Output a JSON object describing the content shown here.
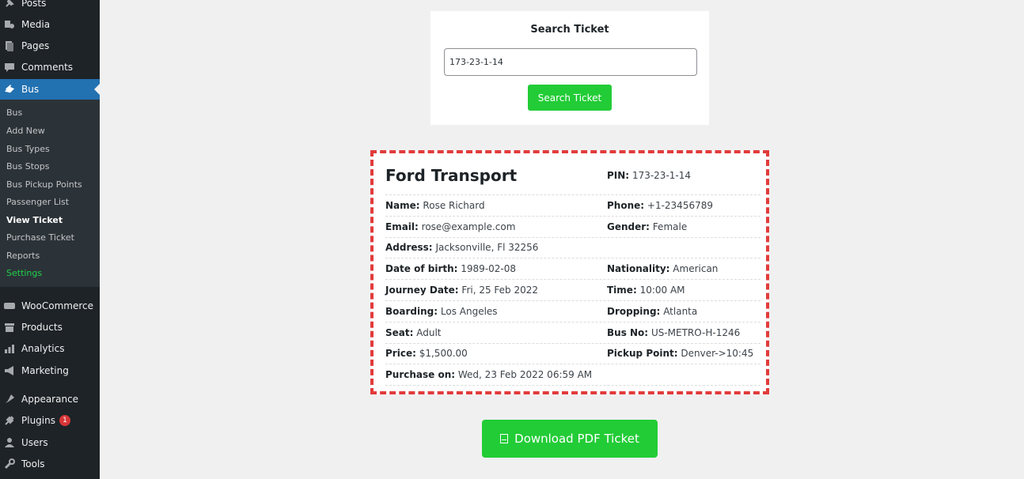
{
  "sidebar": {
    "top_items": [
      {
        "label": "Posts",
        "icon": "pin-icon"
      },
      {
        "label": "Media",
        "icon": "media-icon"
      },
      {
        "label": "Pages",
        "icon": "pages-icon"
      },
      {
        "label": "Comments",
        "icon": "comment-icon"
      }
    ],
    "active_item": {
      "label": "Bus",
      "icon": "bus-icon"
    },
    "submenu": [
      {
        "label": "Bus"
      },
      {
        "label": "Add New"
      },
      {
        "label": "Bus Types"
      },
      {
        "label": "Bus Stops"
      },
      {
        "label": "Bus Pickup Points"
      },
      {
        "label": "Passenger List"
      },
      {
        "label": "View Ticket"
      },
      {
        "label": "Purchase Ticket"
      },
      {
        "label": "Reports"
      },
      {
        "label": "Settings"
      }
    ],
    "bottom_items": [
      {
        "label": "WooCommerce",
        "icon": "woo-icon"
      },
      {
        "label": "Products",
        "icon": "box-icon"
      },
      {
        "label": "Analytics",
        "icon": "chart-icon"
      },
      {
        "label": "Marketing",
        "icon": "megaphone-icon"
      },
      {
        "label": "Appearance",
        "icon": "brush-icon"
      },
      {
        "label": "Plugins",
        "icon": "plug-icon",
        "badge": "1"
      },
      {
        "label": "Users",
        "icon": "user-icon"
      },
      {
        "label": "Tools",
        "icon": "wrench-icon"
      }
    ]
  },
  "search": {
    "title": "Search Ticket",
    "input_value": "173-23-1-14",
    "button_label": "Search Ticket"
  },
  "ticket": {
    "company": "Ford Transport",
    "pin_label": "PIN:",
    "pin": "173-23-1-14",
    "name_label": "Name:",
    "name": "Rose Richard",
    "phone_label": "Phone:",
    "phone": "+1-23456789",
    "email_label": "Email:",
    "email": "rose@example.com",
    "gender_label": "Gender:",
    "gender": "Female",
    "address_label": "Address:",
    "address": "Jacksonville, Fl 32256",
    "dob_label": "Date of birth:",
    "dob": "1989-02-08",
    "nationality_label": "Nationality:",
    "nationality": "American",
    "journey_label": "Journey Date:",
    "journey": "Fri, 25 Feb 2022",
    "time_label": "Time:",
    "time": "10:00 AM",
    "boarding_label": "Boarding:",
    "boarding": "Los Angeles",
    "dropping_label": "Dropping:",
    "dropping": "Atlanta",
    "seat_label": "Seat:",
    "seat": "Adult",
    "busno_label": "Bus No:",
    "busno": "US-METRO-H-1246",
    "price_label": "Price:",
    "price": "$1,500.00",
    "pickup_label": "Pickup Point:",
    "pickup": "Denver->10:45",
    "purchase_label": "Purchase on:",
    "purchase": "Wed, 23 Feb 2022 06:59 AM"
  },
  "download": {
    "label": "Download PDF Ticket",
    "icon": "pdf-icon"
  },
  "colors": {
    "accent_green": "#22cc36",
    "sidebar_active": "#2271b1",
    "ticket_border": "#e23b3b"
  }
}
